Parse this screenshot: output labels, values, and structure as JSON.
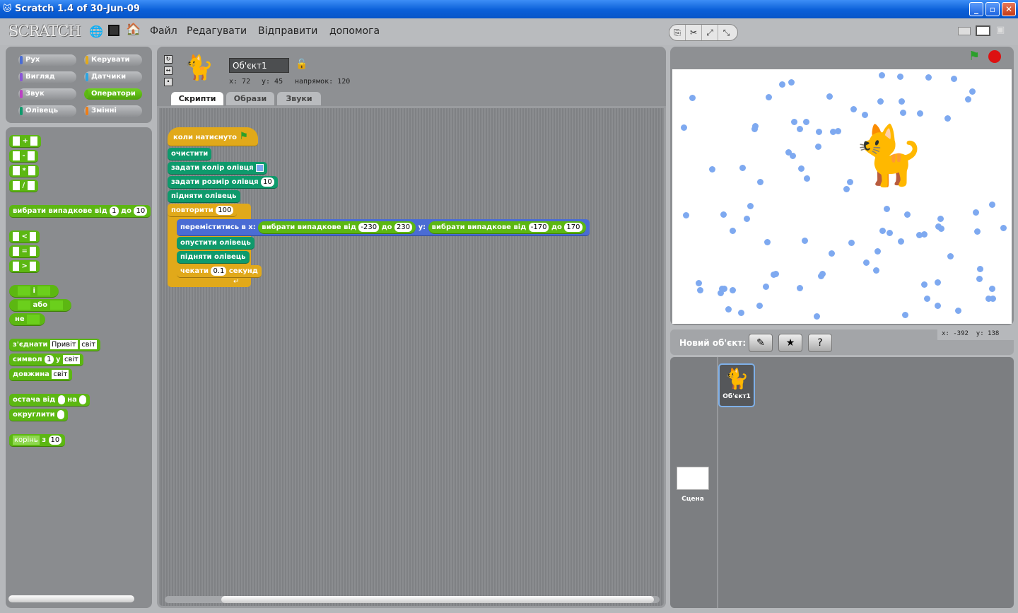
{
  "window": {
    "title": "Scratch 1.4 of 30-Jun-09",
    "min": "_",
    "max": "▫",
    "close": "✕"
  },
  "menu": {
    "logo": "SCRATCH",
    "items": [
      "Файл",
      "Редагувати",
      "Відправити",
      "допомога"
    ]
  },
  "categories": [
    {
      "label": "Рух",
      "color": "#4a6cd4"
    },
    {
      "label": "Керувати",
      "color": "#e1a91a"
    },
    {
      "label": "Вигляд",
      "color": "#8a55d7"
    },
    {
      "label": "Датчики",
      "color": "#2ca5e2"
    },
    {
      "label": "Звук",
      "color": "#bb42c3"
    },
    {
      "label": "Оператори",
      "color": "#5cb712"
    },
    {
      "label": "Олівець",
      "color": "#0e9a6c"
    },
    {
      "label": "Змінні",
      "color": "#ee7d16"
    }
  ],
  "palette": {
    "plus": "+",
    "minus": "-",
    "mult": "*",
    "div": "/",
    "random": "вибрати випадкове від",
    "random_from": "1",
    "to": "до",
    "random_to": "10",
    "lt": "<",
    "eq": "=",
    "gt": ">",
    "and": "і",
    "or": "або",
    "not": "не",
    "join": "з'єднати",
    "join_a": "Привіт",
    "join_b": "світ",
    "letter": "символ",
    "letter_n": "1",
    "letter_of": "у",
    "letter_s": "світ",
    "length": "довжина",
    "length_s": "світ",
    "mod": "остача від",
    "mod_by": "на",
    "round": "округлити",
    "sqrt_fn": "корінь",
    "sqrt_of": "з",
    "sqrt_val": "10"
  },
  "sprite": {
    "name": "Об'єкт1",
    "x_label": "x: 72",
    "y_label": "y: 45",
    "dir_label": "напрямок: 120"
  },
  "tabs": [
    "Скрипти",
    "Образи",
    "Звуки"
  ],
  "script": {
    "hat": "коли натиснуто",
    "clear": "очистити",
    "set_color": "задати колір олівця",
    "set_size": "задати розмір олівця",
    "set_size_val": "10",
    "pen_up": "підняти олівець",
    "repeat": "повторити",
    "repeat_val": "100",
    "goto": "переміститись в x:",
    "rand1": "вибрати випадкове від",
    "rand1_a": "-230",
    "rand1_to": "до",
    "rand1_b": "230",
    "y": "y:",
    "rand2": "вибрати випадкове від",
    "rand2_a": "-170",
    "rand2_to": "до",
    "rand2_b": "170",
    "pen_down": "опустити олівець",
    "pen_up2": "підняти олівець",
    "wait": "чекати",
    "wait_val": "0.1",
    "secs": "секунд"
  },
  "stage": {
    "new_sprite": "Новий об'єкт:",
    "mouse_x": "x: -392",
    "mouse_y": "y: 138",
    "dot_color": "#7ea9f0"
  },
  "sprites_list": {
    "sprite1": "Об'єкт1",
    "stage_label": "Сцена"
  }
}
